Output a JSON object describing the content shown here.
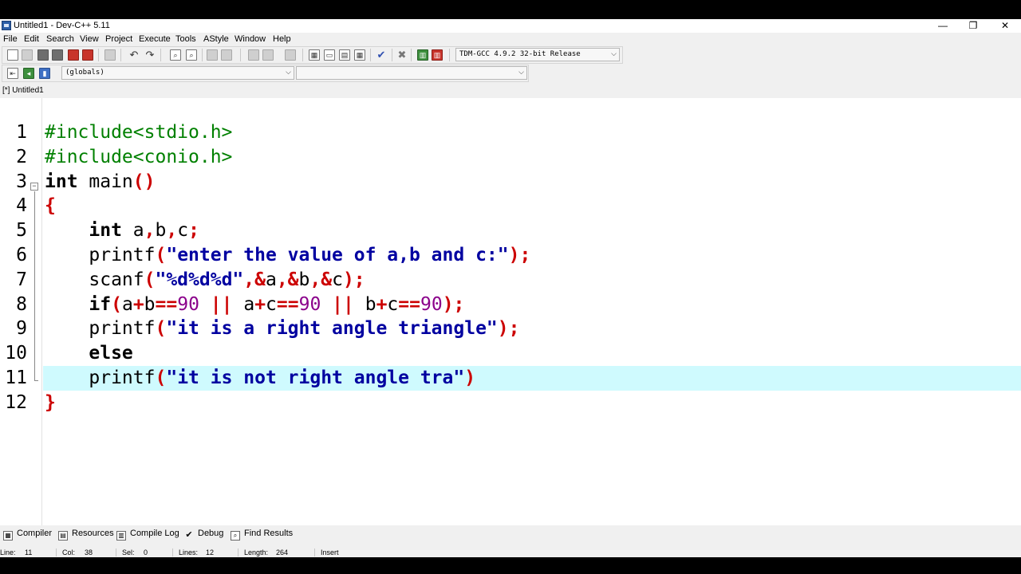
{
  "window": {
    "title": "Untitled1 - Dev-C++ 5.11",
    "controls": {
      "minimize": "—",
      "maximize": "❐",
      "close": "✕"
    }
  },
  "menu": [
    "File",
    "Edit",
    "Search",
    "View",
    "Project",
    "Execute",
    "Tools",
    "AStyle",
    "Window",
    "Help"
  ],
  "toolbar": {
    "compiler_select": "TDM-GCC 4.9.2 32-bit Release",
    "scope_select": "(globals)",
    "member_select": ""
  },
  "tab": {
    "label": "[*] Untitled1"
  },
  "editor": {
    "line_numbers": [
      "1",
      "2",
      "3",
      "4",
      "5",
      "6",
      "7",
      "8",
      "9",
      "10",
      "11",
      "12"
    ],
    "current_line": 11,
    "lines": [
      [
        {
          "t": "#include<stdio.h>",
          "c": "pre"
        }
      ],
      [
        {
          "t": "#include<conio.h>",
          "c": "pre"
        }
      ],
      [
        {
          "t": "int",
          "c": "kw"
        },
        {
          "t": " main",
          "c": "id"
        },
        {
          "t": "()",
          "c": "sym"
        }
      ],
      [
        {
          "t": "{",
          "c": "sym"
        }
      ],
      [
        {
          "t": "    ",
          "c": "id"
        },
        {
          "t": "int",
          "c": "kw"
        },
        {
          "t": " a",
          "c": "id"
        },
        {
          "t": ",",
          "c": "sym"
        },
        {
          "t": "b",
          "c": "id"
        },
        {
          "t": ",",
          "c": "sym"
        },
        {
          "t": "c",
          "c": "id"
        },
        {
          "t": ";",
          "c": "sym"
        }
      ],
      [
        {
          "t": "    printf",
          "c": "id"
        },
        {
          "t": "(",
          "c": "sym"
        },
        {
          "t": "\"enter the value of a,b and c:\"",
          "c": "str"
        },
        {
          "t": ");",
          "c": "sym"
        }
      ],
      [
        {
          "t": "    scanf",
          "c": "id"
        },
        {
          "t": "(",
          "c": "sym"
        },
        {
          "t": "\"%d%d%d\"",
          "c": "str"
        },
        {
          "t": ",&",
          "c": "sym"
        },
        {
          "t": "a",
          "c": "id"
        },
        {
          "t": ",&",
          "c": "sym"
        },
        {
          "t": "b",
          "c": "id"
        },
        {
          "t": ",&",
          "c": "sym"
        },
        {
          "t": "c",
          "c": "id"
        },
        {
          "t": ");",
          "c": "sym"
        }
      ],
      [
        {
          "t": "    ",
          "c": "id"
        },
        {
          "t": "if",
          "c": "kw"
        },
        {
          "t": "(",
          "c": "sym"
        },
        {
          "t": "a",
          "c": "id"
        },
        {
          "t": "+",
          "c": "sym"
        },
        {
          "t": "b",
          "c": "id"
        },
        {
          "t": "==",
          "c": "sym"
        },
        {
          "t": "90",
          "c": "num"
        },
        {
          "t": " || ",
          "c": "sym"
        },
        {
          "t": "a",
          "c": "id"
        },
        {
          "t": "+",
          "c": "sym"
        },
        {
          "t": "c",
          "c": "id"
        },
        {
          "t": "==",
          "c": "sym"
        },
        {
          "t": "90",
          "c": "num"
        },
        {
          "t": " || ",
          "c": "sym"
        },
        {
          "t": "b",
          "c": "id"
        },
        {
          "t": "+",
          "c": "sym"
        },
        {
          "t": "c",
          "c": "id"
        },
        {
          "t": "==",
          "c": "sym"
        },
        {
          "t": "90",
          "c": "num"
        },
        {
          "t": ");",
          "c": "sym"
        }
      ],
      [
        {
          "t": "    printf",
          "c": "id"
        },
        {
          "t": "(",
          "c": "sym"
        },
        {
          "t": "\"it is a right angle triangle\"",
          "c": "str"
        },
        {
          "t": ");",
          "c": "sym"
        }
      ],
      [
        {
          "t": "    ",
          "c": "id"
        },
        {
          "t": "else",
          "c": "kw"
        }
      ],
      [
        {
          "t": "    printf",
          "c": "id"
        },
        {
          "t": "(",
          "c": "sym"
        },
        {
          "t": "\"it is not right angle tra\"",
          "c": "str"
        },
        {
          "t": ")",
          "c": "sym"
        }
      ],
      [
        {
          "t": "}",
          "c": "sym"
        }
      ]
    ]
  },
  "panels": [
    "Compiler",
    "Resources",
    "Compile Log",
    "Debug",
    "Find Results"
  ],
  "panel_icons": [
    "grid-icon",
    "resources-icon",
    "chart-icon",
    "check-icon",
    "find-icon"
  ],
  "status": {
    "line_label": "Line:",
    "line_value": "11",
    "col_label": "Col:",
    "col_value": "38",
    "sel_label": "Sel:",
    "sel_value": "0",
    "lines_label": "Lines:",
    "lines_value": "12",
    "length_label": "Length:",
    "length_value": "264",
    "mode": "Insert"
  },
  "colors": {
    "preprocessor": "#008000",
    "symbol": "#cc0000",
    "string": "#0000a0",
    "number": "#8b008b",
    "current_line_bg": "#cffafe"
  }
}
